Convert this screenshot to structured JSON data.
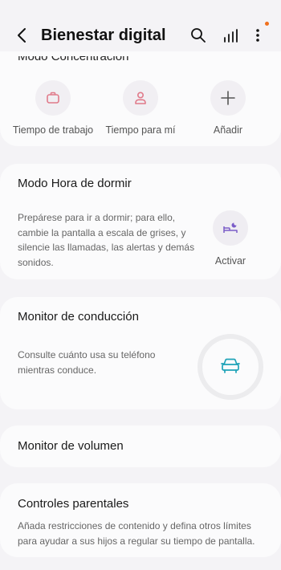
{
  "header": {
    "title": "Bienestar digital"
  },
  "focus": {
    "title_partial": "Modo Concentración",
    "modes": [
      {
        "label": "Tiempo de trabajo",
        "icon": "briefcase-icon"
      },
      {
        "label": "Tiempo para mí",
        "icon": "person-icon"
      },
      {
        "label": "Añadir",
        "icon": "plus-icon"
      }
    ]
  },
  "sleep": {
    "title": "Modo Hora de dormir",
    "description": "Prepárese para ir a dormir; para ello, cambie la pantalla a escala de grises, y silencie las llamadas, las alertas y demás sonidos.",
    "action_label": "Activar"
  },
  "driving": {
    "title": "Monitor de conducción",
    "description": "Consulte cuánto usa su teléfono mientras conduce."
  },
  "volume": {
    "title": "Monitor de volumen"
  },
  "parental": {
    "title": "Controles parentales",
    "description": "Añada restricciones de contenido y defina otros límites para ayudar a sus hijos a regular su tiempo de pantalla."
  },
  "colors": {
    "accent_pink": "#e07a8a",
    "accent_purple": "#7a5cc8",
    "accent_teal": "#1fa3b8",
    "notification_dot": "#f0701d"
  }
}
